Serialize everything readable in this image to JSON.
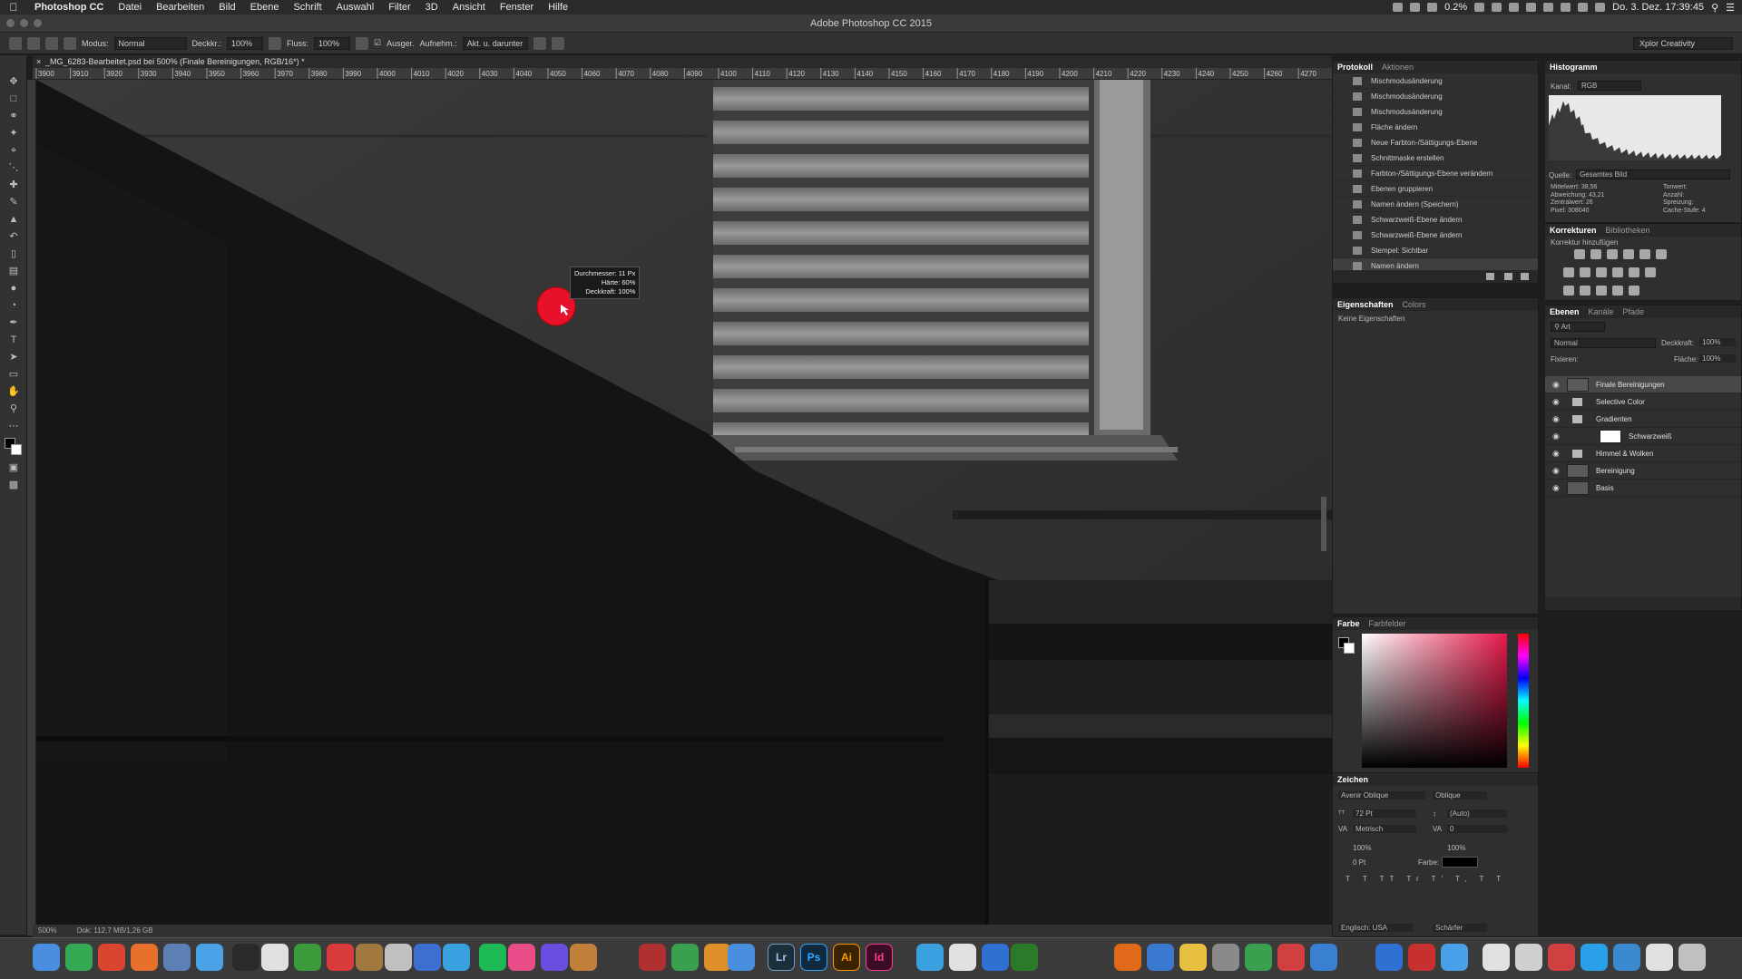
{
  "menubar": {
    "app": "Photoshop CC",
    "items": [
      "Datei",
      "Bearbeiten",
      "Bild",
      "Ebene",
      "Schrift",
      "Auswahl",
      "Filter",
      "3D",
      "Ansicht",
      "Fenster",
      "Hilfe"
    ],
    "cpu": "0.2%",
    "clock": "Do. 3. Dez. 17:39:45"
  },
  "window": {
    "title": "Adobe Photoshop CC 2015"
  },
  "options": {
    "mode_label": "Modus:",
    "mode_value": "Normal",
    "opacity_label": "Deckkr.:",
    "opacity_value": "100%",
    "flow_label": "Fluss:",
    "flow_value": "100%",
    "aligned_label": "Ausger.",
    "sample_label": "Aufnehm.:",
    "sample_value": "Akt. u. darunter",
    "workspace": "Xplor Creativity"
  },
  "document": {
    "tab": "_MG_6283-Bearbeitet.psd bei 500% (Finale Bereinigungen, RGB/16*) *",
    "status": "500%",
    "doc_info": "Dok: 112,7 MB/1,26 GB",
    "ruler_labels": [
      "3900",
      "3910",
      "3920",
      "3930",
      "3940",
      "3950",
      "3960",
      "3970",
      "3980",
      "3990",
      "4000",
      "4010",
      "4020",
      "4030",
      "4040",
      "4050",
      "4060",
      "4070",
      "4080",
      "4090",
      "4100",
      "4110",
      "4120",
      "4130",
      "4140",
      "4150",
      "4160",
      "4170",
      "4180",
      "4190",
      "4200",
      "4210",
      "4220",
      "4230",
      "4240",
      "4250",
      "4260",
      "4270"
    ]
  },
  "brush_tooltip": {
    "line1": "Durchmesser: 11 Px",
    "line2": "Härte: 60%",
    "line3": "Deckkraft: 100%"
  },
  "history_panel": {
    "tabs": [
      "Protokoll",
      "Aktionen"
    ],
    "items": [
      "Mischmodusänderung",
      "Mischmodusänderung",
      "Mischmodusänderung",
      "Fläche ändern",
      "Neue Farbton-/Sättigungs-Ebene",
      "Schnittmaske erstellen",
      "Farbton-/Sättigungs-Ebene verändern",
      "Ebenen gruppieren",
      "Namen ändern (Speichern)",
      "Schwarzweiß-Ebene ändern",
      "Schwarzweiß-Ebene ändern",
      "Stempel: Sichtbar",
      "Namen ändern"
    ]
  },
  "properties_panel": {
    "tabs": [
      "Eigenschaften",
      "Colors"
    ],
    "empty_text": "Keine Eigenschaften"
  },
  "histogram_panel": {
    "title": "Histogramm",
    "channel_label": "Kanal:",
    "channel_value": "RGB",
    "source_label": "Quelle:",
    "source_value": "Gesamtes Bild",
    "stats_left": [
      "Mittelwert: 38,56",
      "Abweichung: 43,21",
      "Zentralwert: 26",
      "Pixel: 308040"
    ],
    "stats_right": [
      "Tonwert:",
      "Anzahl:",
      "Spreizung:",
      "Cache-Stufe: 4"
    ]
  },
  "corrections_panel": {
    "tabs": [
      "Korrekturen",
      "Bibliotheken"
    ],
    "add_label": "Korrektur hinzufügen"
  },
  "layers_panel": {
    "tabs": [
      "Ebenen",
      "Kanäle",
      "Pfade"
    ],
    "filter_label": "Art",
    "blend_mode": "Normal",
    "opacity_label": "Deckkraft:",
    "opacity_value": "100%",
    "lock_label": "Fixieren:",
    "fill_label": "Fläche:",
    "fill_value": "100%",
    "layers": [
      {
        "name": "Finale Bereinigungen",
        "kind": "pixel",
        "selected": true
      },
      {
        "name": "Selective Color",
        "kind": "folder",
        "selected": false
      },
      {
        "name": "Gradienten",
        "kind": "folder",
        "selected": false
      },
      {
        "name": "Schwarzweiß",
        "kind": "adjustment",
        "selected": false
      },
      {
        "name": "Himmel & Wolken",
        "kind": "folder",
        "selected": false
      },
      {
        "name": "Bereinigung",
        "kind": "pixel",
        "selected": false
      },
      {
        "name": "Basis",
        "kind": "pixel",
        "selected": false
      }
    ]
  },
  "color_panel": {
    "tabs": [
      "Farbe",
      "Farbfelder"
    ],
    "hue_color": "#e8184a"
  },
  "character_panel": {
    "title": "Zeichen",
    "font_family": "Avenir Oblique",
    "font_style": "Oblique",
    "size": "72 Pt",
    "leading": "(Auto)",
    "kerning": "Metrisch",
    "tracking": "0",
    "vscale": "100%",
    "hscale": "100%",
    "baseline": "0 Pt",
    "color_label": "Farbe:",
    "language": "Englisch: USA",
    "antialias": "Schärfer"
  },
  "dock": {
    "apps": [
      {
        "label": "Lr",
        "color": "#1b2f3b"
      },
      {
        "label": "Ps",
        "color": "#0f2a3f"
      },
      {
        "label": "Ai",
        "color": "#3a2300"
      },
      {
        "label": "Id",
        "color": "#3b0d24"
      }
    ]
  }
}
